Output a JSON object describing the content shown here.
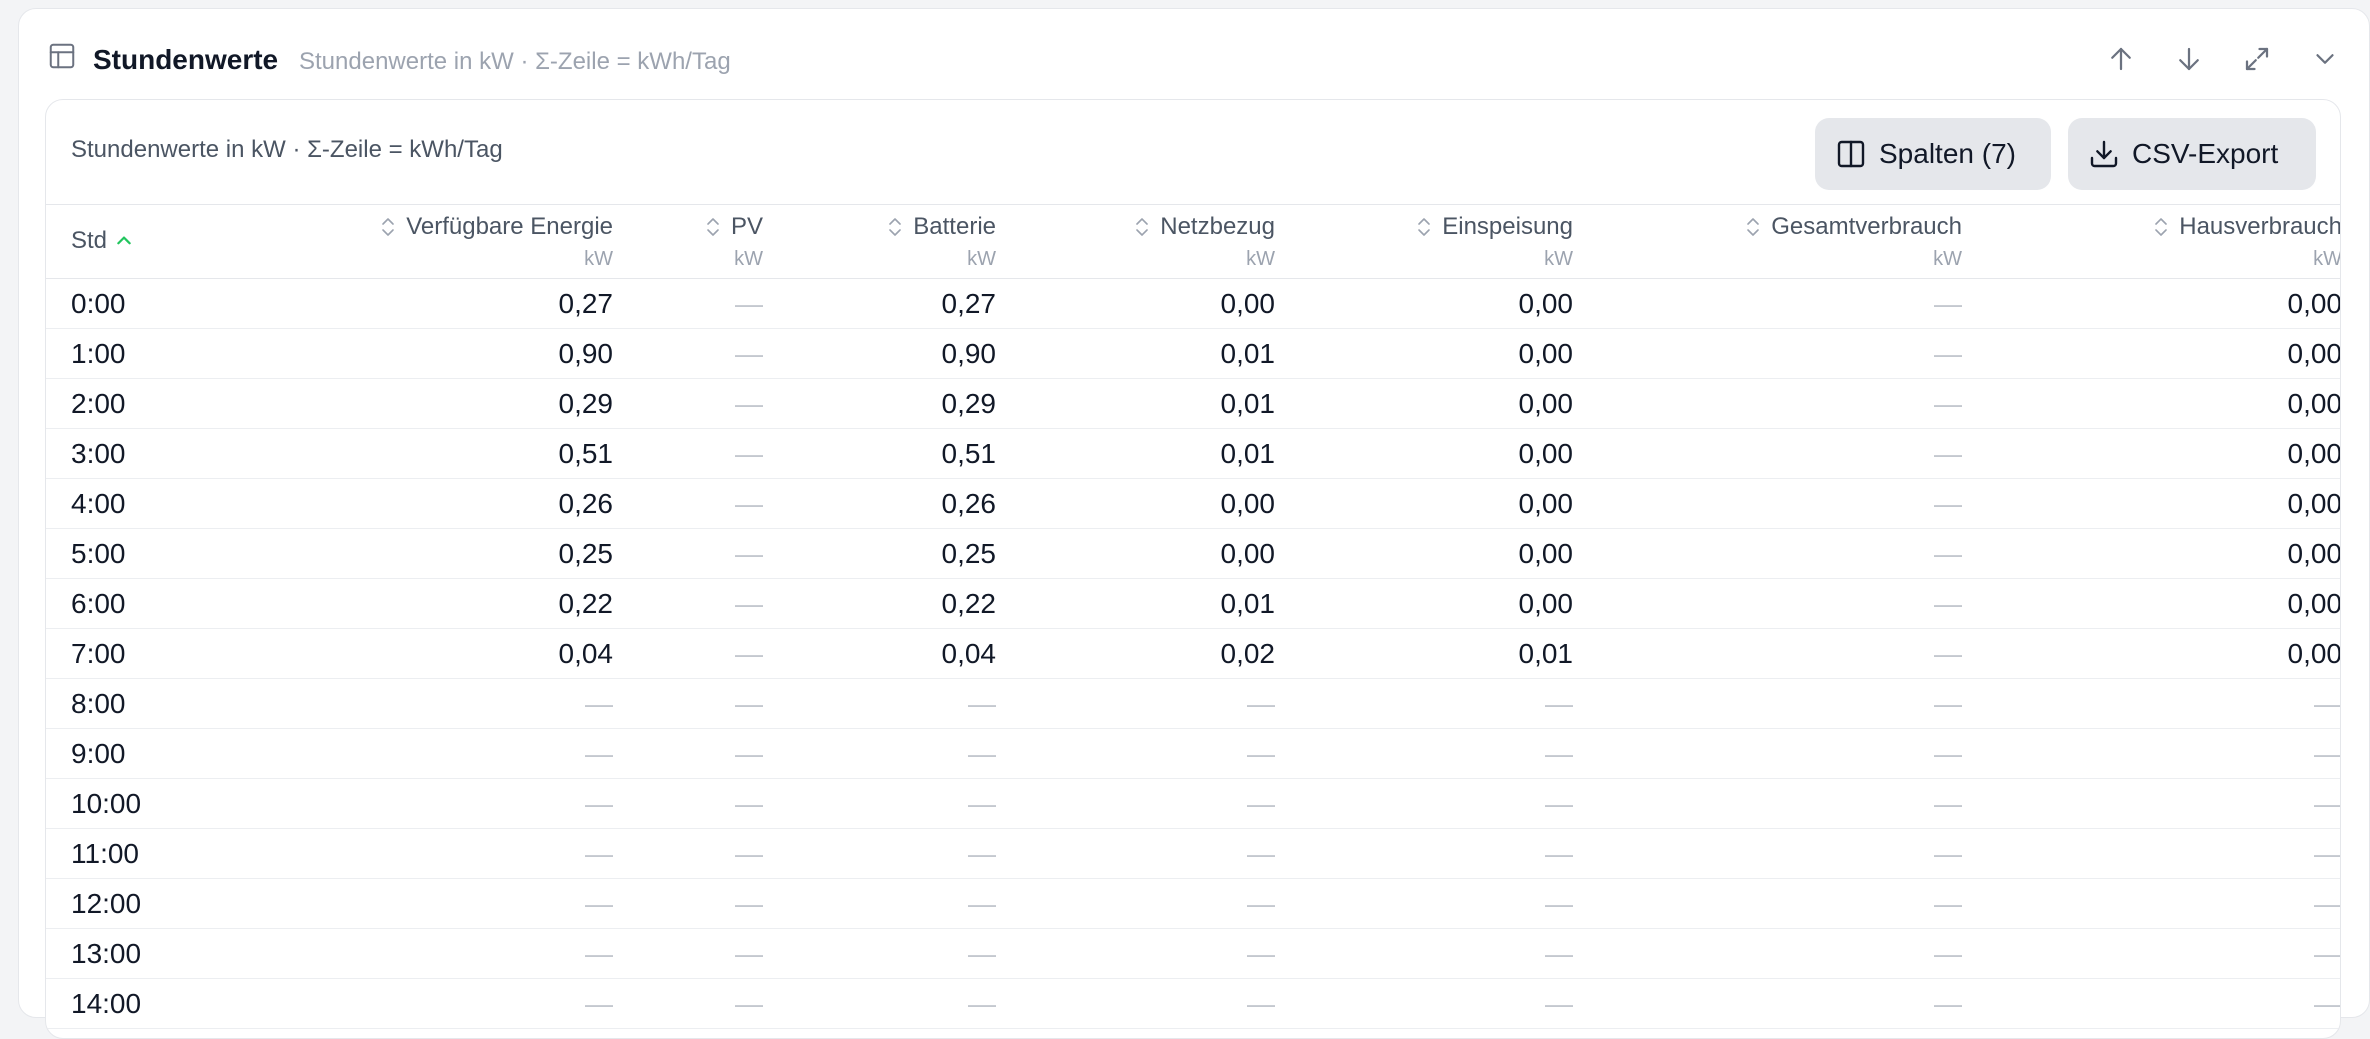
{
  "panel": {
    "title": "Stundenwerte",
    "subtitle": "Stundenwerte in kW · Σ-Zeile = kWh/Tag"
  },
  "icons": {
    "panel": "table-icon",
    "move_up": "arrow-up-icon",
    "move_down": "arrow-down-icon",
    "expand": "expand-icon",
    "collapse": "chevron-down-icon",
    "columns": "columns-icon",
    "download": "download-icon",
    "sort": "sort-icon",
    "sort_asc": "sort-ascending-icon"
  },
  "colors": {
    "accent": "#22c55e",
    "button_bg": "#e5e7eb",
    "muted": "#9ca3af",
    "dash": "#c4c8cf"
  },
  "card": {
    "caption": "Stundenwerte in kW · Σ-Zeile = kWh/Tag",
    "columns_button": "Spalten (7)",
    "export_button": "CSV-Export"
  },
  "table": {
    "columns": [
      {
        "key": "std",
        "label": "Std",
        "unit": "",
        "sorted": "asc"
      },
      {
        "key": "energie",
        "label": "Verfügbare Energie",
        "unit": "kW"
      },
      {
        "key": "pv",
        "label": "PV",
        "unit": "kW"
      },
      {
        "key": "batterie",
        "label": "Batterie",
        "unit": "kW"
      },
      {
        "key": "netzbezug",
        "label": "Netzbezug",
        "unit": "kW"
      },
      {
        "key": "einspeisung",
        "label": "Einspeisung",
        "unit": "kW"
      },
      {
        "key": "gesamt",
        "label": "Gesamtverbrauch",
        "unit": "kW"
      },
      {
        "key": "haus",
        "label": "Hausverbrauch",
        "unit": "kW"
      }
    ],
    "rows": [
      [
        "0:00",
        "0,27",
        "—",
        "0,27",
        "0,00",
        "0,00",
        "—",
        "0,00"
      ],
      [
        "1:00",
        "0,90",
        "—",
        "0,90",
        "0,01",
        "0,00",
        "—",
        "0,00"
      ],
      [
        "2:00",
        "0,29",
        "—",
        "0,29",
        "0,01",
        "0,00",
        "—",
        "0,00"
      ],
      [
        "3:00",
        "0,51",
        "—",
        "0,51",
        "0,01",
        "0,00",
        "—",
        "0,00"
      ],
      [
        "4:00",
        "0,26",
        "—",
        "0,26",
        "0,00",
        "0,00",
        "—",
        "0,00"
      ],
      [
        "5:00",
        "0,25",
        "—",
        "0,25",
        "0,00",
        "0,00",
        "—",
        "0,00"
      ],
      [
        "6:00",
        "0,22",
        "—",
        "0,22",
        "0,01",
        "0,00",
        "—",
        "0,00"
      ],
      [
        "7:00",
        "0,04",
        "—",
        "0,04",
        "0,02",
        "0,01",
        "—",
        "0,00"
      ],
      [
        "8:00",
        "—",
        "—",
        "—",
        "—",
        "—",
        "—",
        "—"
      ],
      [
        "9:00",
        "—",
        "—",
        "—",
        "—",
        "—",
        "—",
        "—"
      ],
      [
        "10:00",
        "—",
        "—",
        "—",
        "—",
        "—",
        "—",
        "—"
      ],
      [
        "11:00",
        "—",
        "—",
        "—",
        "—",
        "—",
        "—",
        "—"
      ],
      [
        "12:00",
        "—",
        "—",
        "—",
        "—",
        "—",
        "—",
        "—"
      ],
      [
        "13:00",
        "—",
        "—",
        "—",
        "—",
        "—",
        "—",
        "—"
      ],
      [
        "14:00",
        "—",
        "—",
        "—",
        "—",
        "—",
        "—",
        "—"
      ]
    ]
  }
}
